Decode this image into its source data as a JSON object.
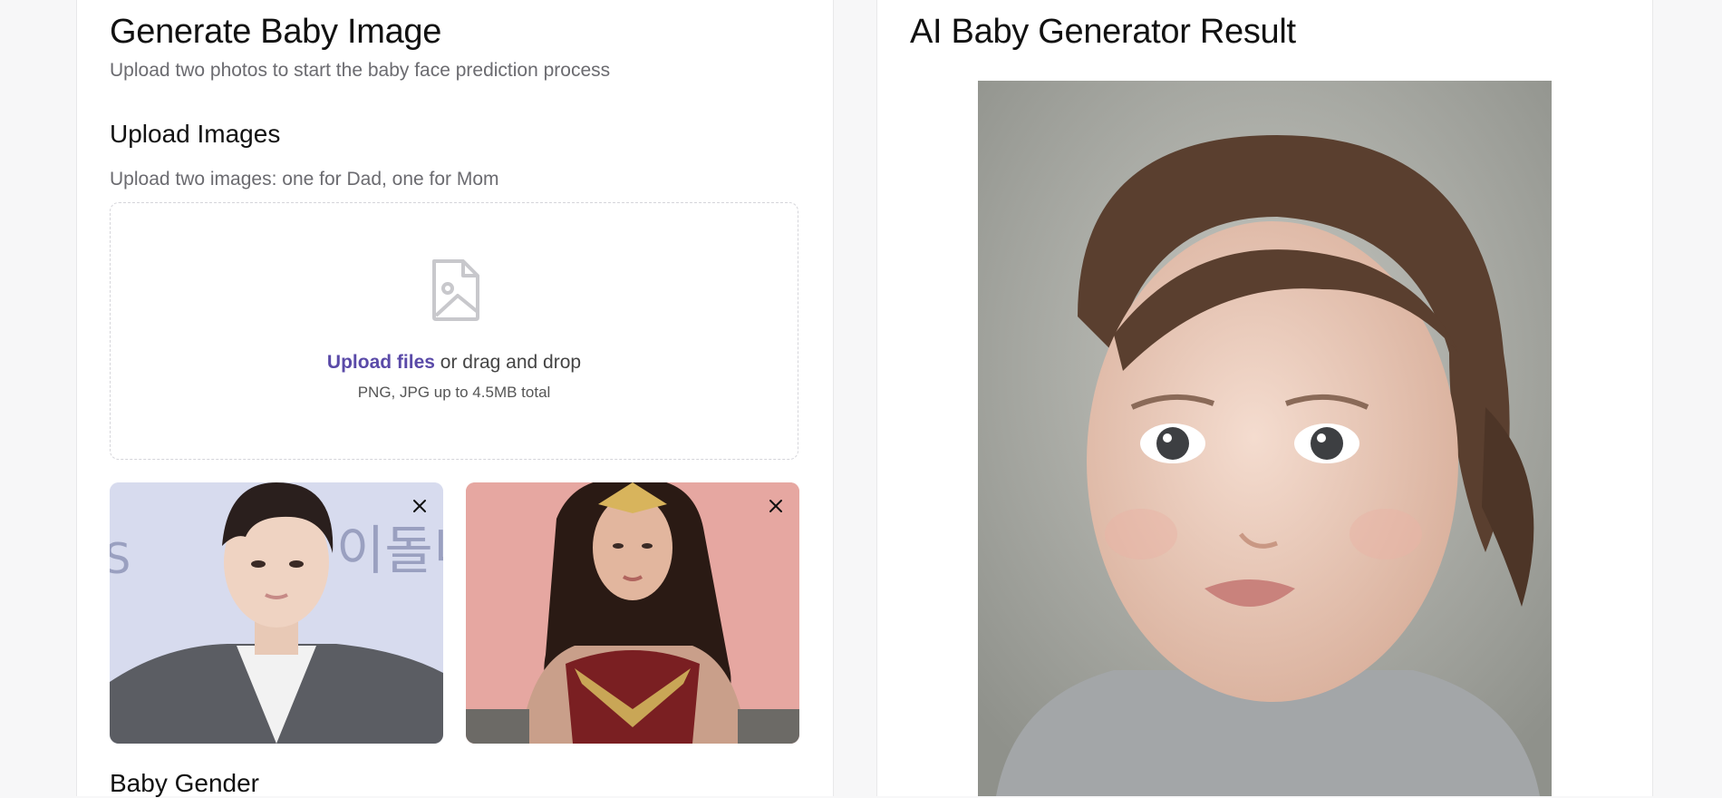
{
  "left_panel": {
    "title": "Generate Baby Image",
    "subtitle": "Upload two photos to start the baby face prediction process",
    "upload_section": {
      "heading": "Upload Images",
      "hint": "Upload two images: one for Dad, one for Mom",
      "dropzone": {
        "icon": "image-file-icon",
        "link_label": "Upload files",
        "text_after_link": " or drag and drop",
        "sub_text": "PNG, JPG up to 4.5MB total"
      },
      "thumbnails": [
        {
          "role": "dad",
          "remove_icon": "close-icon"
        },
        {
          "role": "mom",
          "remove_icon": "close-icon"
        }
      ]
    },
    "gender_section": {
      "heading": "Baby Gender"
    }
  },
  "right_panel": {
    "title": "AI Baby Generator Result"
  },
  "colors": {
    "accent_link": "#5a4aa8",
    "muted_text": "#6b6b70",
    "page_bg": "#f7f7f8"
  }
}
